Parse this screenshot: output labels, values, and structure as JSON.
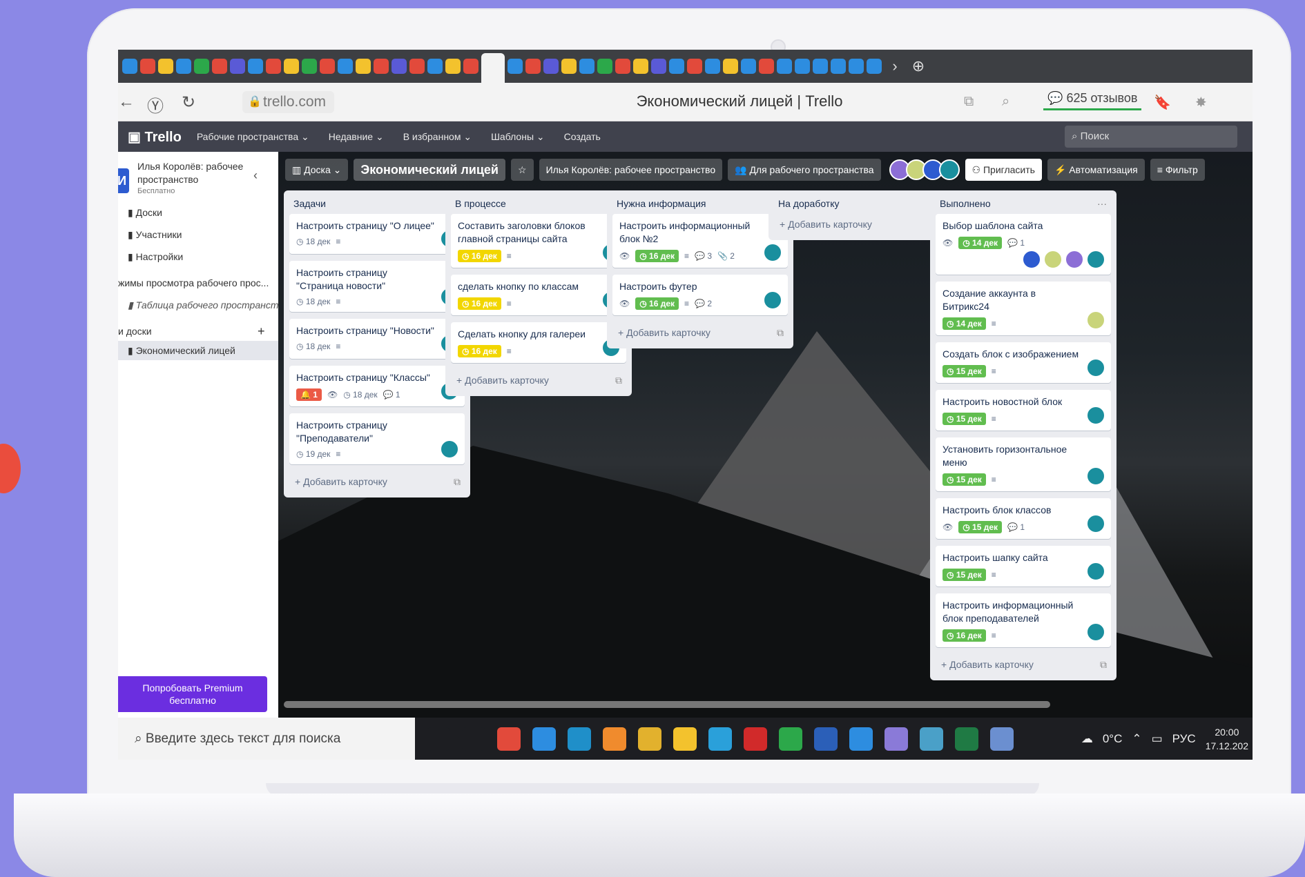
{
  "browser": {
    "url": "trello.com",
    "page_title": "Экономический лицей | Trello",
    "reviews": "625 отзывов"
  },
  "trello": {
    "logo": "Trello",
    "nav": [
      "Рабочие пространства ⌄",
      "Недавние ⌄",
      "В избранном ⌄",
      "Шаблоны ⌄",
      "Создать"
    ],
    "search_placeholder": "Поиск"
  },
  "sidebar": {
    "badge": "И",
    "workspace_name": "Илья Королёв: рабочее пространство",
    "plan": "Бесплатно",
    "items": [
      "Доски",
      "Участники",
      "Настройки"
    ],
    "views_header": "жимы просмотра рабочего прос...",
    "views_item": "Таблица рабочего пространств",
    "boards_header": "и доски",
    "board": "Экономический лицей",
    "premium": "Попробовать Premium бесплатно"
  },
  "board": {
    "view": "Доска ⌄",
    "title": "Экономический лицей",
    "workspace": "Илья Королёв: рабочее пространство",
    "visibility": "Для рабочего пространства",
    "invite": "Пригласить",
    "automation": "Автоматизация",
    "filter": "Фильтр",
    "add_card": "Добавить карточку",
    "lists": [
      {
        "name": "Задачи",
        "cards": [
          {
            "title": "Настроить страницу \"О лицее\"",
            "due": "18 дек",
            "style": "plain",
            "comments": ""
          },
          {
            "title": "Настроить страницу \"Страница новости\"",
            "due": "18 дек",
            "style": "plain",
            "comments": ""
          },
          {
            "title": "Настроить страницу \"Новости\"",
            "due": "18 дек",
            "style": "plain",
            "comments": ""
          },
          {
            "title": "Настроить страницу \"Классы\"",
            "due": "18 дек",
            "style": "plain",
            "comments": "1",
            "alert": "1"
          },
          {
            "title": "Настроить страницу \"Преподаватели\"",
            "due": "19 дек",
            "style": "plain",
            "comments": ""
          }
        ]
      },
      {
        "name": "В процессе",
        "cards": [
          {
            "title": "Составить заголовки блоков главной страницы сайта",
            "due": "16 дек",
            "style": "yellow",
            "comments": ""
          },
          {
            "title": "сделать кнопку по классам",
            "due": "16 дек",
            "style": "yellow",
            "comments": ""
          },
          {
            "title": "Сделать кнопку для галереи",
            "due": "16 дек",
            "style": "yellow",
            "comments": ""
          }
        ]
      },
      {
        "name": "Нужна информация",
        "cards": [
          {
            "title": "Настроить информационный блок №2",
            "due": "16 дек",
            "style": "green",
            "comments": "3",
            "attachments": "2"
          },
          {
            "title": "Настроить футер",
            "due": "16 дек",
            "style": "green",
            "comments": "2"
          }
        ]
      },
      {
        "name": "На доработку",
        "cards": []
      },
      {
        "name": "Выполнено",
        "cards": [
          {
            "title": "Выбор шаблона сайта",
            "due": "14 дек",
            "style": "green",
            "comments": "1"
          },
          {
            "title": "Создание аккаунта в Битрикс24",
            "due": "14 дек",
            "style": "green",
            "comments": ""
          },
          {
            "title": "Создать блок с изображением",
            "due": "15 дек",
            "style": "green",
            "comments": ""
          },
          {
            "title": "Настроить новостной блок",
            "due": "15 дек",
            "style": "green",
            "comments": ""
          },
          {
            "title": "Установить горизонтальное меню",
            "due": "15 дек",
            "style": "green",
            "comments": ""
          },
          {
            "title": "Настроить блок классов",
            "due": "15 дек",
            "style": "green",
            "comments": "1"
          },
          {
            "title": "Настроить шапку сайта",
            "due": "15 дек",
            "style": "green",
            "comments": ""
          },
          {
            "title": "Настроить информационный блок преподавателей",
            "due": "16 дек",
            "style": "green",
            "comments": ""
          }
        ]
      }
    ]
  },
  "taskbar": {
    "search": "Введите здесь текст для поиска",
    "weather": "0°C",
    "lang": "РУС",
    "time": "20:00",
    "date": "17.12.202"
  },
  "colors": {
    "background": "#8b88e6",
    "trello_header": "#40424d",
    "premium": "#6b2ee0",
    "due_green": "#61bd4f",
    "due_yellow": "#f2d600"
  }
}
